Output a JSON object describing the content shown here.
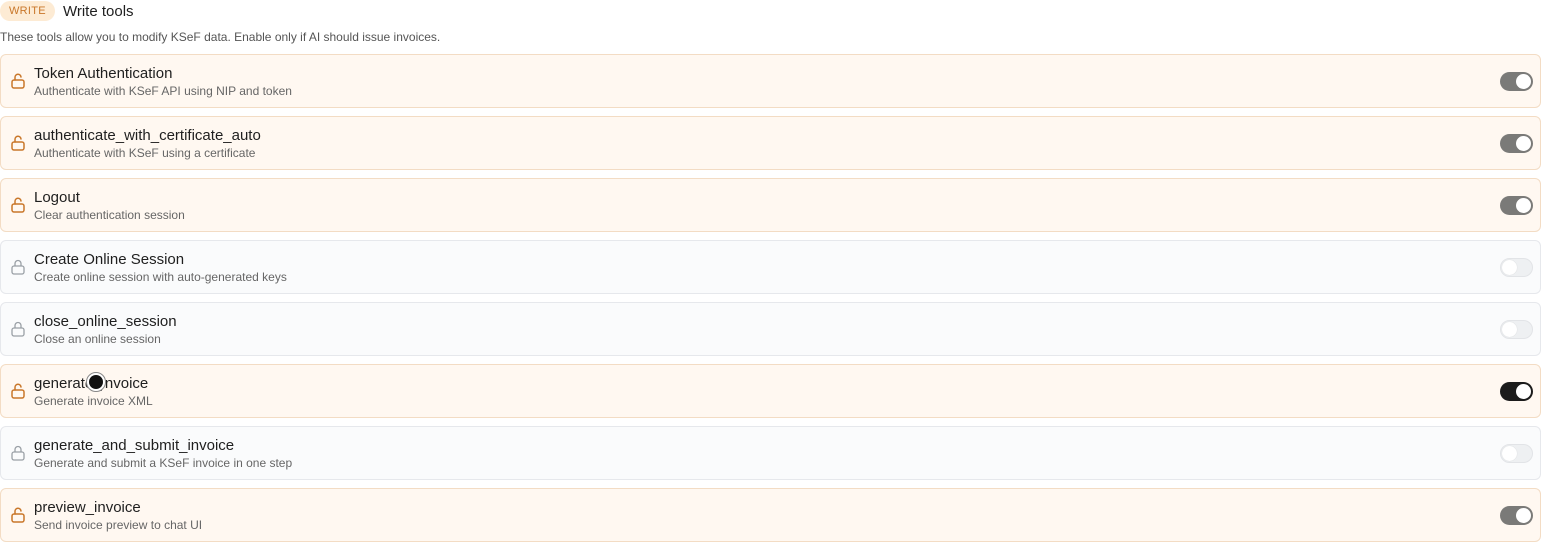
{
  "section": {
    "badge": "WRITE",
    "title": "Write tools",
    "description": "These tools allow you to modify KSeF data. Enable only if AI should issue invoices."
  },
  "tools": [
    {
      "name": "Token Authentication",
      "description": "Authenticate with KSeF API using NIP and token",
      "enabled": true,
      "focused": false
    },
    {
      "name": "authenticate_with_certificate_auto",
      "description": "Authenticate with KSeF using a certificate",
      "enabled": true,
      "focused": false
    },
    {
      "name": "Logout",
      "description": "Clear authentication session",
      "enabled": true,
      "focused": false
    },
    {
      "name": "Create Online Session",
      "description": "Create online session with auto-generated keys",
      "enabled": false,
      "focused": false
    },
    {
      "name": "close_online_session",
      "description": "Close an online session",
      "enabled": false,
      "focused": false
    },
    {
      "name": "generate_invoice",
      "description": "Generate invoice XML",
      "enabled": true,
      "focused": true
    },
    {
      "name": "generate_and_submit_invoice",
      "description": "Generate and submit a KSeF invoice in one step",
      "enabled": false,
      "focused": false
    },
    {
      "name": "preview_invoice",
      "description": "Send invoice preview to chat UI",
      "enabled": true,
      "focused": false
    }
  ],
  "colors": {
    "accent": "#c9772a",
    "badge_bg": "#fdebd4",
    "enabled_row_bg": "#fff8f1",
    "disabled_row_bg": "#fafbfc",
    "toggle_on": "#7a7a78",
    "toggle_on_focused": "#1b1b1b",
    "lock_disabled": "#9aa0a6"
  },
  "icons": {
    "enabled": "lock-open-icon",
    "disabled": "lock-icon"
  }
}
